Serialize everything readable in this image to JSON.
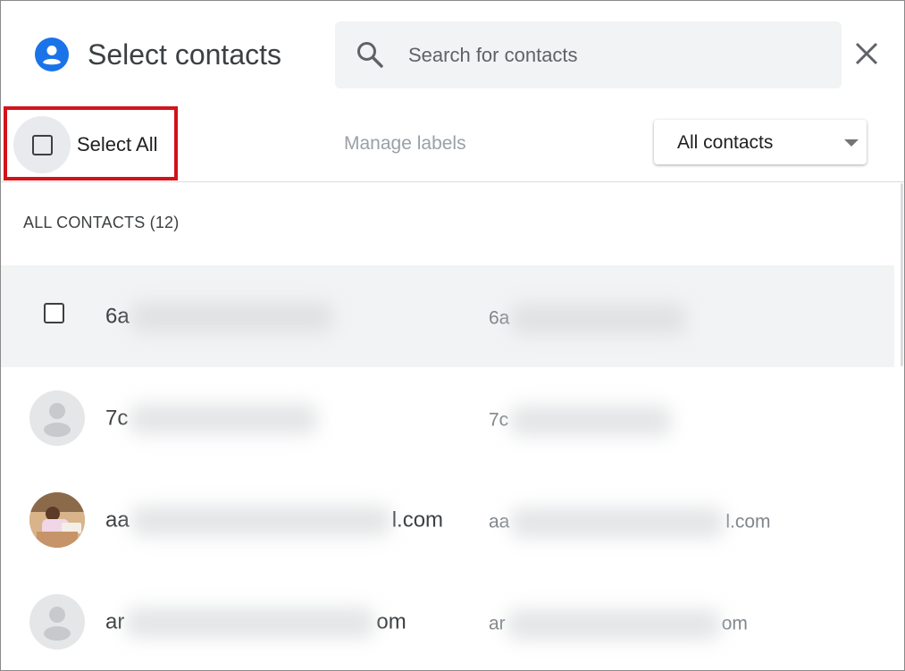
{
  "header": {
    "title": "Select contacts",
    "search_placeholder": "Search for contacts"
  },
  "toolbar": {
    "select_all_label": "Select All",
    "manage_labels": "Manage labels",
    "filter_selected": "All contacts"
  },
  "list": {
    "section_header": "ALL CONTACTS (12)",
    "rows": [
      {
        "name_prefix": "6a",
        "name_suffix": "",
        "email_prefix": "6a",
        "email_suffix": "",
        "avatar": "checkbox"
      },
      {
        "name_prefix": "7c",
        "name_suffix": "",
        "email_prefix": "7c",
        "email_suffix": "",
        "avatar": "person-placeholder-icon"
      },
      {
        "name_prefix": "aa",
        "name_suffix": "l.com",
        "email_prefix": "aa",
        "email_suffix": "l.com",
        "avatar": "photo"
      },
      {
        "name_prefix": "ar",
        "name_suffix": "om",
        "email_prefix": "ar",
        "email_suffix": "om",
        "avatar": "person-placeholder-icon"
      }
    ]
  },
  "colors": {
    "accent_blue": "#1a73e8",
    "highlight_red": "#d2131a",
    "search_bg": "#f1f3f4",
    "hover_row_bg": "#f1f3f4"
  }
}
